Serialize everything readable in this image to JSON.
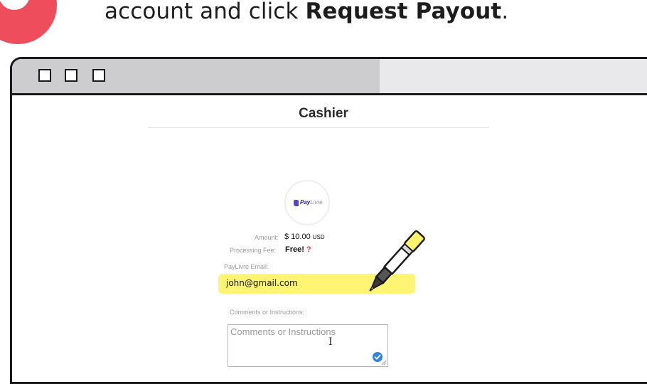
{
  "instruction": {
    "prefix": "account and click ",
    "bold": "Request Payout",
    "suffix": "."
  },
  "window": {
    "buttons": [
      "window-button-1",
      "window-button-2",
      "window-button-3"
    ]
  },
  "cashier": {
    "title": "Cashier",
    "logo": {
      "brand_bold": "Pay",
      "brand_light": "Livre"
    },
    "amount": {
      "label": "Amount:",
      "value": "$ 10.00",
      "currency": "USD"
    },
    "fee": {
      "label": "Processing Fee:",
      "value": "Free!",
      "help": "?"
    },
    "email": {
      "label": "PayLivre Email:",
      "value": "john@gmail.com"
    },
    "comments": {
      "label": "Comments or Instructions:",
      "placeholder": "Comments or Instructions"
    }
  },
  "colors": {
    "step_badge": "#ee4d5b",
    "highlight": "#fff46a",
    "titlebar": "#cdcdcf",
    "check_badge": "#2f82e6"
  },
  "icons": [
    "step-number-badge",
    "paylivre-logo-icon",
    "text-cursor-icon",
    "checkmark-icon",
    "resize-handle-icon",
    "highlighter-marker-icon"
  ]
}
